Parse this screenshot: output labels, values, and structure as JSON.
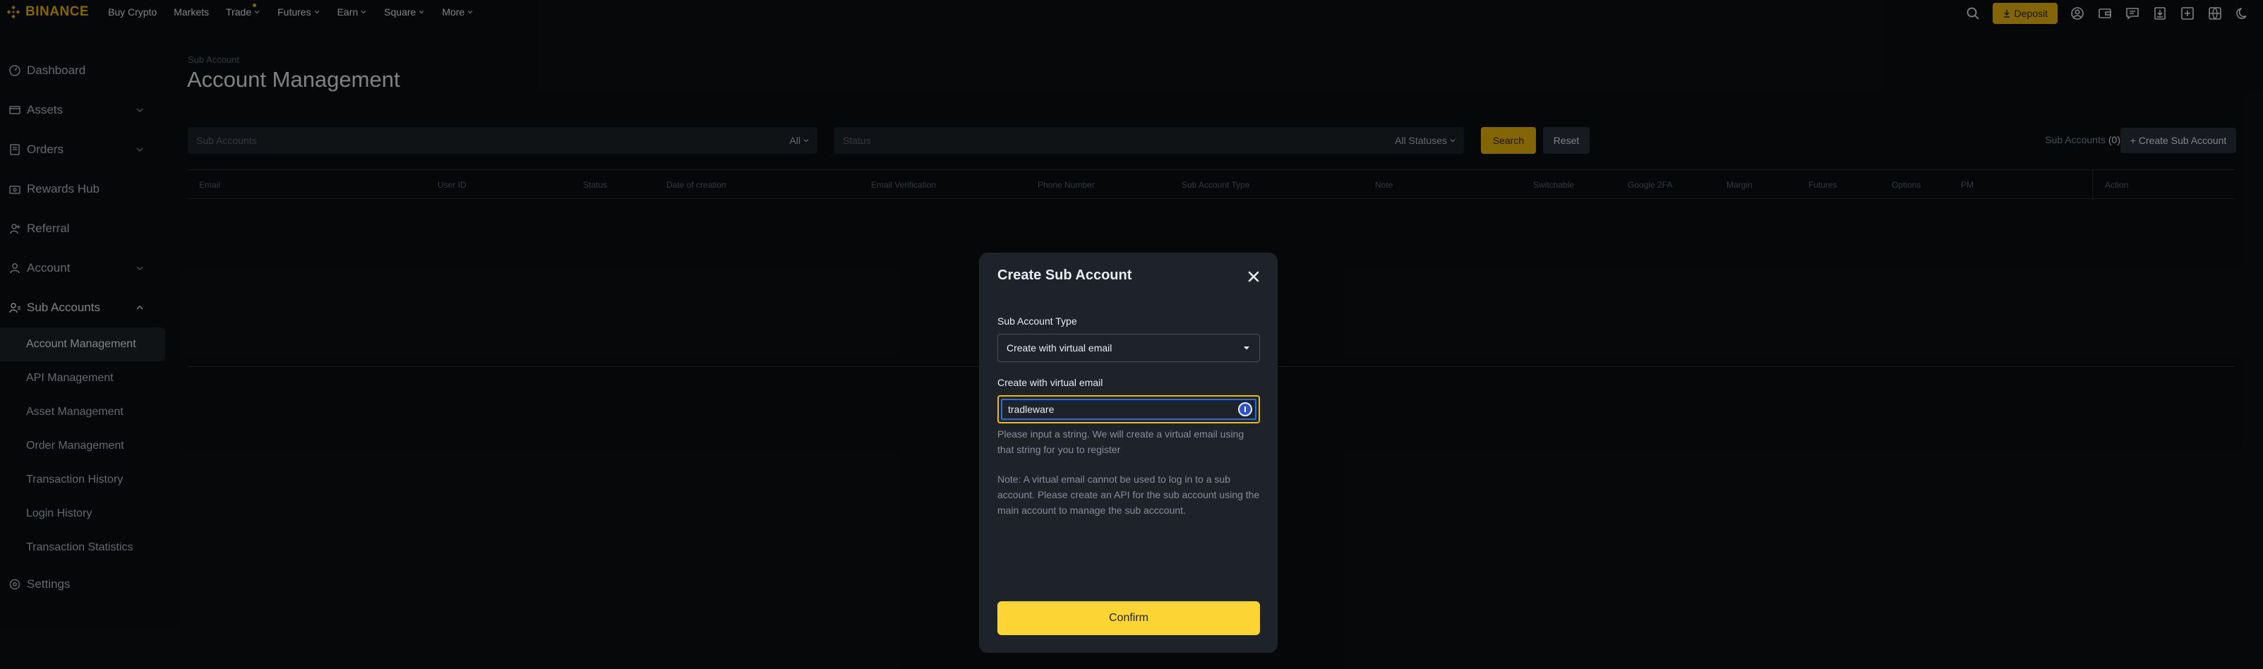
{
  "brand": {
    "name": "BINANCE",
    "accent": "#f0b90b"
  },
  "nav": {
    "items": [
      {
        "label": "Buy Crypto",
        "dropdown": false,
        "dot": false
      },
      {
        "label": "Markets",
        "dropdown": false,
        "dot": false
      },
      {
        "label": "Trade",
        "dropdown": true,
        "dot": true
      },
      {
        "label": "Futures",
        "dropdown": true,
        "dot": false
      },
      {
        "label": "Earn",
        "dropdown": true,
        "dot": false
      },
      {
        "label": "Square",
        "dropdown": true,
        "dot": false
      },
      {
        "label": "More",
        "dropdown": true,
        "dot": false
      }
    ],
    "deposit_label": "Deposit",
    "icons": [
      "search-icon",
      "user-icon",
      "wallet-icon",
      "message-icon",
      "download-icon",
      "import-icon",
      "globe-icon",
      "theme-moon-icon"
    ]
  },
  "sidebar": {
    "items": [
      {
        "label": "Dashboard",
        "icon": "dashboard-icon",
        "expandable": false
      },
      {
        "label": "Assets",
        "icon": "wallet-icon",
        "expandable": true
      },
      {
        "label": "Orders",
        "icon": "orders-icon",
        "expandable": true
      },
      {
        "label": "Rewards Hub",
        "icon": "reward-icon",
        "expandable": false
      },
      {
        "label": "Referral",
        "icon": "referral-icon",
        "expandable": false
      },
      {
        "label": "Account",
        "icon": "account-icon",
        "expandable": true
      },
      {
        "label": "Sub Accounts",
        "icon": "sub-accounts-icon",
        "expandable": true,
        "open": true
      }
    ],
    "sub_items": [
      {
        "label": "Account Management",
        "active": true
      },
      {
        "label": "API Management",
        "active": false
      },
      {
        "label": "Asset Management",
        "active": false
      },
      {
        "label": "Order Management",
        "active": false
      },
      {
        "label": "Transaction History",
        "active": false
      },
      {
        "label": "Login History",
        "active": false
      },
      {
        "label": "Transaction Statistics",
        "active": false
      }
    ],
    "settings": {
      "label": "Settings",
      "icon": "settings-icon"
    }
  },
  "main": {
    "breadcrumb": "Sub Account",
    "title": "Account Management",
    "filters": {
      "sub_accounts_placeholder": "Sub Accounts",
      "sub_accounts_select": "All",
      "status_placeholder": "Status",
      "status_select": "All Statuses"
    },
    "search_label": "Search",
    "reset_label": "Reset",
    "sub_accounts_count_label": "Sub Accounts",
    "sub_accounts_count": "(0)",
    "create_button_label": "+ Create Sub Account",
    "table_columns": [
      "Email",
      "User ID",
      "Status",
      "Date of creation",
      "Email Verification",
      "Phone Number",
      "Sub Account Type",
      "Note",
      "Switchable",
      "Google 2FA",
      "Margin",
      "Futures",
      "Options",
      "PM",
      "Action"
    ]
  },
  "modal": {
    "title": "Create Sub Account",
    "type_label": "Sub Account Type",
    "type_value": "Create with virtual email",
    "email_label": "Create with virtual email",
    "email_value": "tradleware",
    "help_text": "Please input a string. We will create a virtual email using that string for you to register",
    "note_text": "Note: A virtual email cannot be used to log in to a sub account. Please create an API for the sub account using the main account to manage the sub acccount.",
    "confirm_label": "Confirm"
  }
}
